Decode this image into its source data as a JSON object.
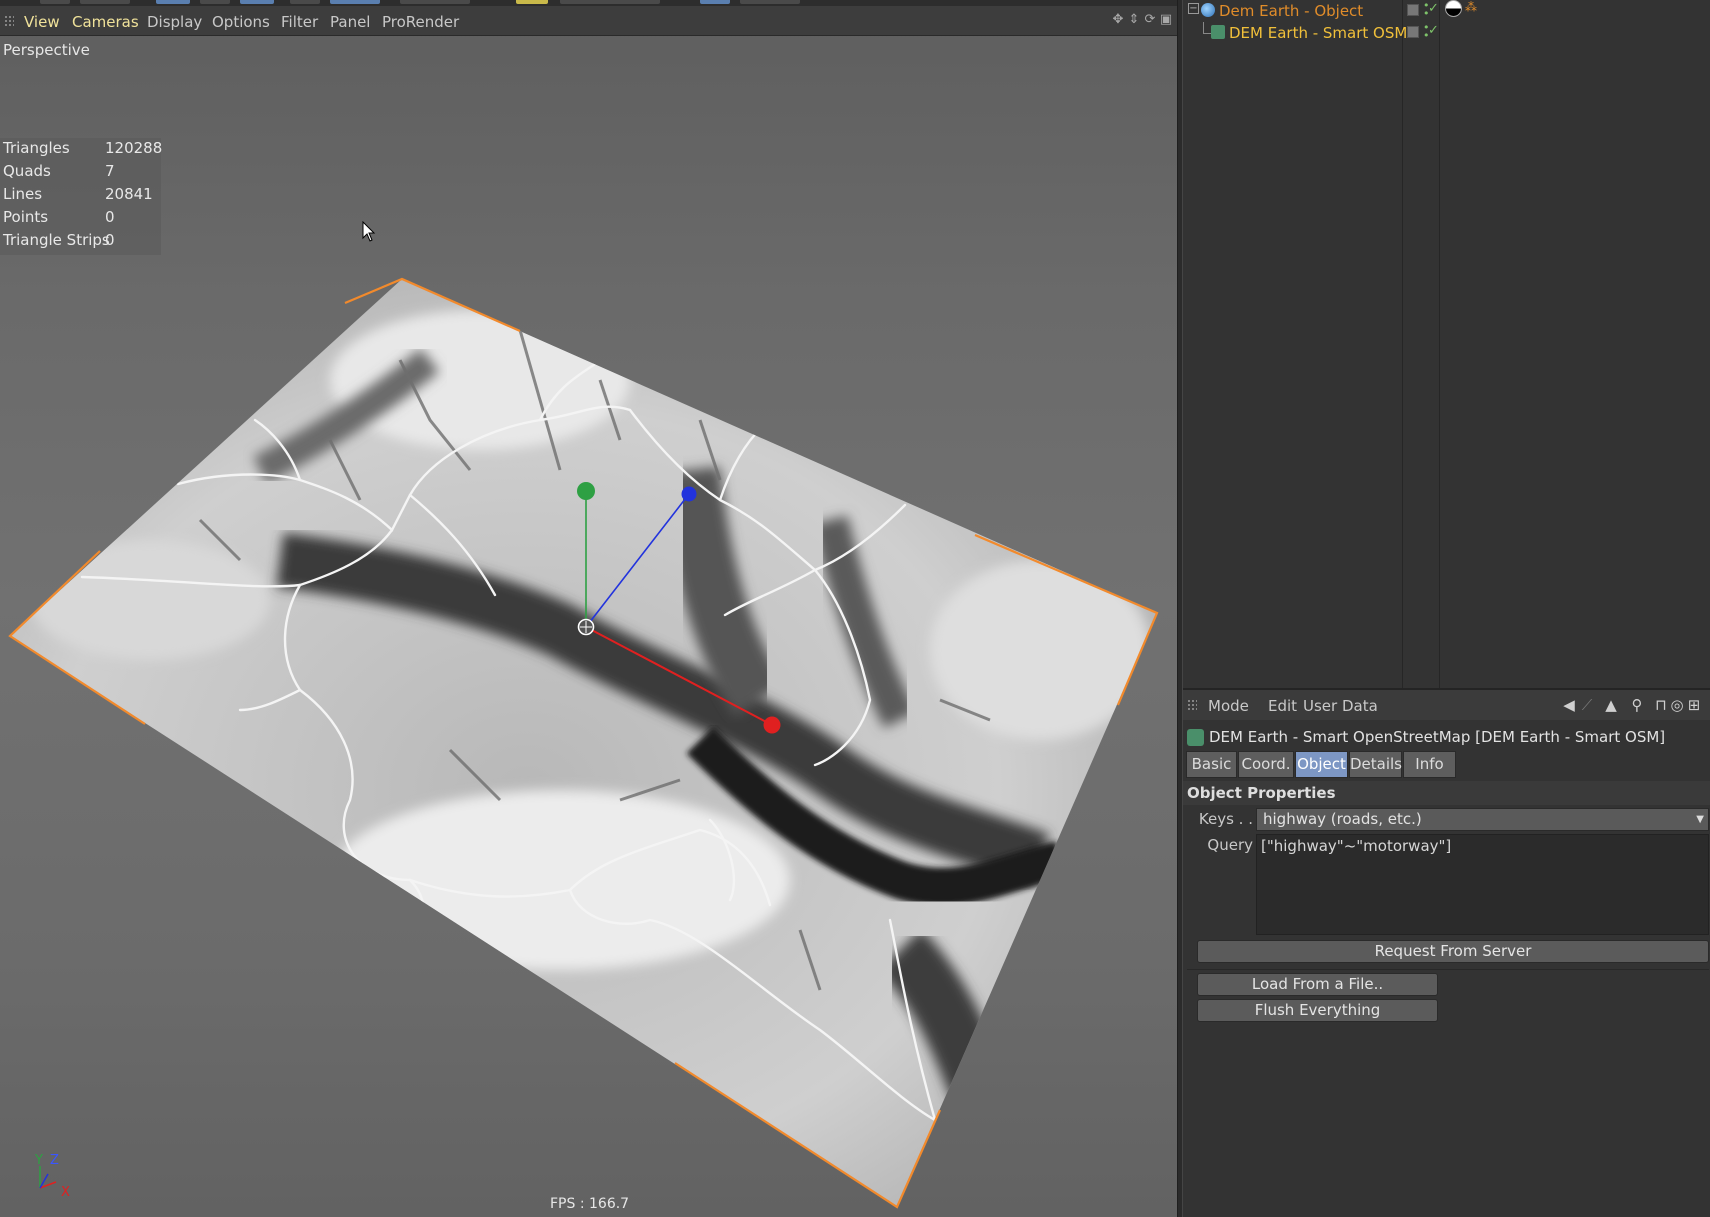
{
  "viewport": {
    "menu": [
      "View",
      "Cameras",
      "Display",
      "Options",
      "Filter",
      "Panel",
      "ProRender"
    ],
    "camera_label": "Perspective",
    "stats": [
      {
        "label": "Triangles",
        "value": "120288"
      },
      {
        "label": "Quads",
        "value": "7"
      },
      {
        "label": "Lines",
        "value": "20841"
      },
      {
        "label": "Points",
        "value": "0"
      },
      {
        "label": "Triangle Strips",
        "value": "0"
      }
    ],
    "fps": "FPS : 166.7",
    "axis_labels": {
      "y": "Y",
      "z": "Z",
      "x": "X"
    },
    "nav_icons": [
      "move-view-icon",
      "zoom-view-icon",
      "rotate-view-icon",
      "maximize-view-icon"
    ],
    "colors": {
      "x_axis": "#e02020",
      "y_axis": "#2ea043",
      "z_axis": "#2233dd",
      "selection_outline": "#f28a2c"
    }
  },
  "object_manager": {
    "objects": [
      {
        "name": "Dem Earth - Object",
        "selected": false,
        "icon": "dem-earth-icon"
      },
      {
        "name": "DEM Earth - Smart OSM",
        "selected": true,
        "icon": "smart-osm-icon"
      }
    ],
    "colors": {
      "object_name": "#e08c2a",
      "selected_name": "#f1c03a"
    }
  },
  "attributes": {
    "menu": [
      "Mode",
      "Edit",
      "User Data"
    ],
    "toolbar_icons": [
      "back-arrow-icon",
      "forward-arrow-icon",
      "up-arrow-icon",
      "search-icon",
      "lock-icon",
      "target-icon",
      "new-panel-icon"
    ],
    "title": "DEM Earth - Smart OpenStreetMap [DEM Earth - Smart OSM]",
    "tabs": [
      {
        "label": "Basic",
        "active": false
      },
      {
        "label": "Coord.",
        "active": false
      },
      {
        "label": "Object",
        "active": true
      },
      {
        "label": "Details",
        "active": false
      },
      {
        "label": "Info",
        "active": false
      }
    ],
    "section_title": "Object Properties",
    "keys_label": "Keys . .",
    "keys_value": "highway  (roads, etc.)",
    "query_label": "Query",
    "query_value": "[\"highway\"~\"motorway\"]",
    "buttons": {
      "request": "Request From Server",
      "load": "Load From a File..",
      "flush": "Flush Everything"
    }
  }
}
